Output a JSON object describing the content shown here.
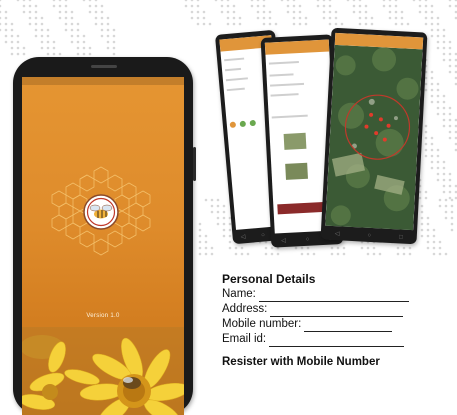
{
  "splash": {
    "version_text": "Version 1.0",
    "logo_name": "bee-logo",
    "background_color": "#de8b2b",
    "accent_color": "#f2c84b"
  },
  "form": {
    "title": "Personal Details",
    "fields": [
      {
        "label": "Name:"
      },
      {
        "label": "Address:"
      },
      {
        "label": "Mobile number:"
      },
      {
        "label": "Email id:"
      }
    ],
    "submit_label": "Resister with Mobile Number"
  },
  "icons": [
    "bee-logo-icon",
    "honeycomb-icon",
    "sunflower-image",
    "map-image",
    "back-nav-icon",
    "home-nav-icon",
    "recent-nav-icon"
  ]
}
